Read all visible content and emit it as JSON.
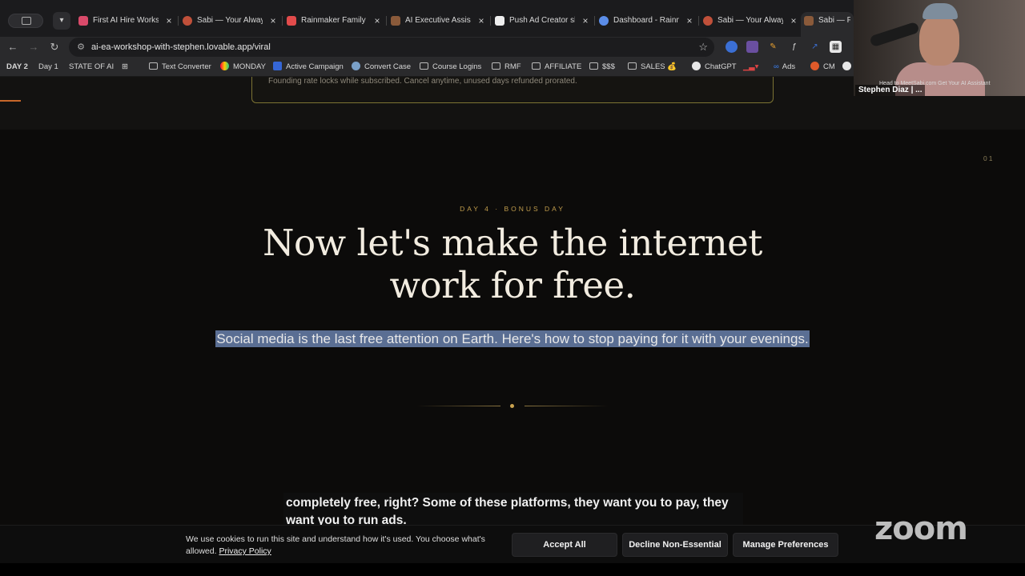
{
  "tabs": [
    {
      "title": "First AI Hire Works",
      "color": "#d94a6a"
    },
    {
      "title": "Sabi — Your Alway",
      "color": "#c0503a"
    },
    {
      "title": "Rainmaker Family",
      "color": "#e24b4b"
    },
    {
      "title": "AI Executive Assis",
      "color": "#8a5a3a"
    },
    {
      "title": "Push Ad Creator sl",
      "color": "#eeeeee"
    },
    {
      "title": "Dashboard - Rainm",
      "color": "#5b8de8"
    },
    {
      "title": "Sabi — Your Alway",
      "color": "#c0503a"
    },
    {
      "title": "Sabi — Fo",
      "color": "#8a5a3a"
    }
  ],
  "address": {
    "url": "ai-ea-workshop-with-stephen.lovable.app/viral"
  },
  "bookmarks": [
    {
      "label": "DAY 2"
    },
    {
      "label": "Day 1"
    },
    {
      "label": "STATE OF AI"
    },
    {
      "label": "Text Converter"
    },
    {
      "label": "MONDAY"
    },
    {
      "label": "Active Campaign"
    },
    {
      "label": "Convert Case"
    },
    {
      "label": "Course Logins"
    },
    {
      "label": "RMF"
    },
    {
      "label": "AFFILIATE"
    },
    {
      "label": "$$$"
    },
    {
      "label": "SALES 💰"
    },
    {
      "label": "ChatGPT"
    },
    {
      "label": "Ads"
    },
    {
      "label": "CM"
    }
  ],
  "page": {
    "offer_note": "Founding rate locks while subscribed. Cancel anytime, unused days refunded prorated.",
    "section_number": "01",
    "eyebrow": "DAY 4 · BONUS DAY",
    "headline_line1": "Now let's make the internet",
    "headline_line2": "work for free.",
    "subheadline": "Social media is the last free attention on Earth. Here's how to stop paying for it with your evenings."
  },
  "caption": "completely free, right? Some of these platforms, they want you to pay, they want you to run ads.",
  "cookie": {
    "text": "We use cookies to run this site and understand how it's used. You choose what's allowed.",
    "policy_link": "Privacy Policy",
    "accept": "Accept All",
    "decline": "Decline Non-Essential",
    "manage": "Manage Preferences"
  },
  "zoom": {
    "logo": "zoom",
    "participant_name": "Stephen Diaz | ...",
    "video_banner": "Head to MeetSabi.com Get Your AI Assistant"
  },
  "colors": {
    "accent_gold": "#c09c4c",
    "selection": "#5a6e93",
    "page_bg": "#0c0b0a"
  }
}
